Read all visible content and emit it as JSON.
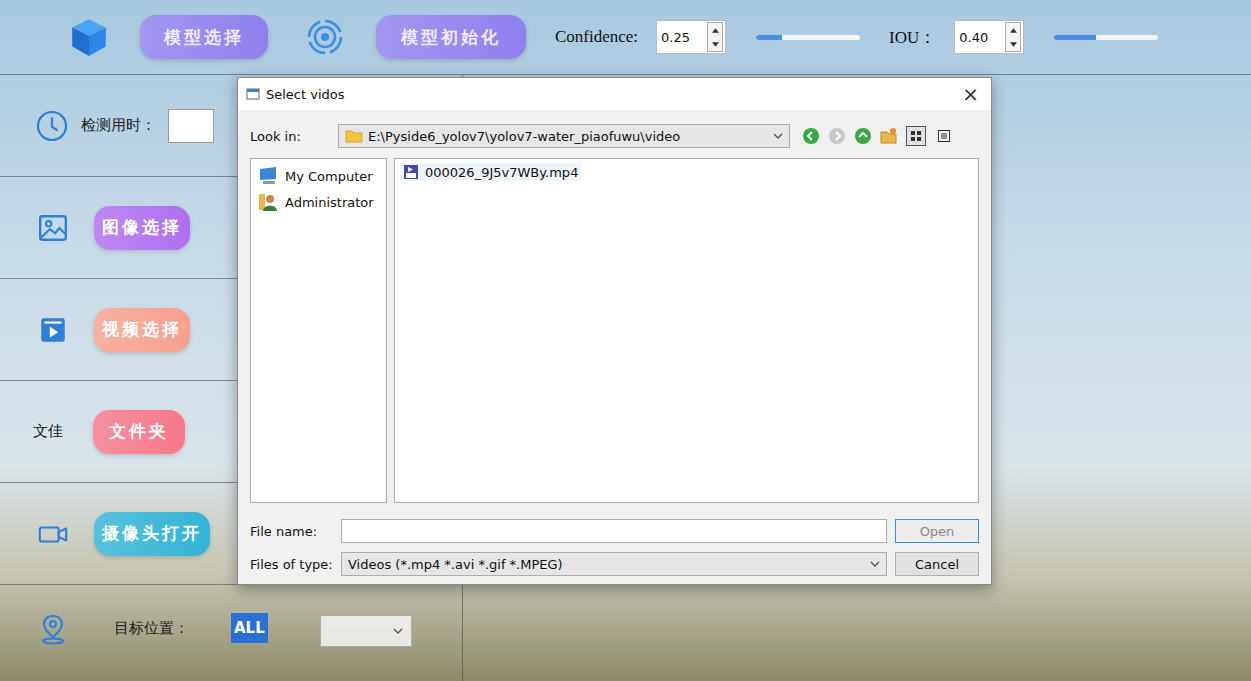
{
  "toolbar": {
    "model_select": "模型选择",
    "model_init": "模型初始化",
    "params": [
      {
        "label": "Confidence:",
        "value": "0.25",
        "level": 0.25
      },
      {
        "label": "IOU：",
        "value": "0.40",
        "level": 0.4
      }
    ]
  },
  "panel": {
    "detect_time": {
      "label": "检测用时：",
      "value": ""
    },
    "actions": [
      {
        "kind": "image",
        "label": "图像选择",
        "caption": "",
        "color": "#b06ff0"
      },
      {
        "kind": "video",
        "label": "视频选择",
        "caption": "",
        "color": "#f7a08e"
      },
      {
        "kind": "folder",
        "label": "文件夹",
        "caption": "文佳",
        "color": "#f6788a"
      },
      {
        "kind": "camera",
        "label": "摄像头打开",
        "caption": "",
        "color": "#33b4d6"
      }
    ],
    "target": {
      "label": "目标位置：",
      "badge": "ALL",
      "value": ""
    }
  },
  "dialog": {
    "title": "Select vidos",
    "close": "×",
    "look_in_label": "Look in:",
    "path": "E:\\Pyside6_yolov7\\yolov7-water_piaofuwu\\video",
    "nav": {
      "back_enabled": true,
      "forward_enabled": false,
      "up_enabled": true
    },
    "view_buttons": [
      {
        "kind": "icons",
        "selected": true
      },
      {
        "kind": "detail",
        "selected": false
      }
    ],
    "places": [
      {
        "kind": "computer",
        "label": "My Computer",
        "selected": false
      },
      {
        "kind": "user",
        "label": "Administrator",
        "selected": false
      }
    ],
    "files": [
      {
        "name": "000026_9J5v7WBy.mp4",
        "selected": false
      }
    ],
    "file_name_label": "File name:",
    "file_name": "",
    "open_button": {
      "label": "Open",
      "disabled": true
    },
    "type_label": "Files of type:",
    "file_type": "Videos (*.mp4 *.avi *.gif *.MPEG)",
    "cancel": "Cancel"
  }
}
